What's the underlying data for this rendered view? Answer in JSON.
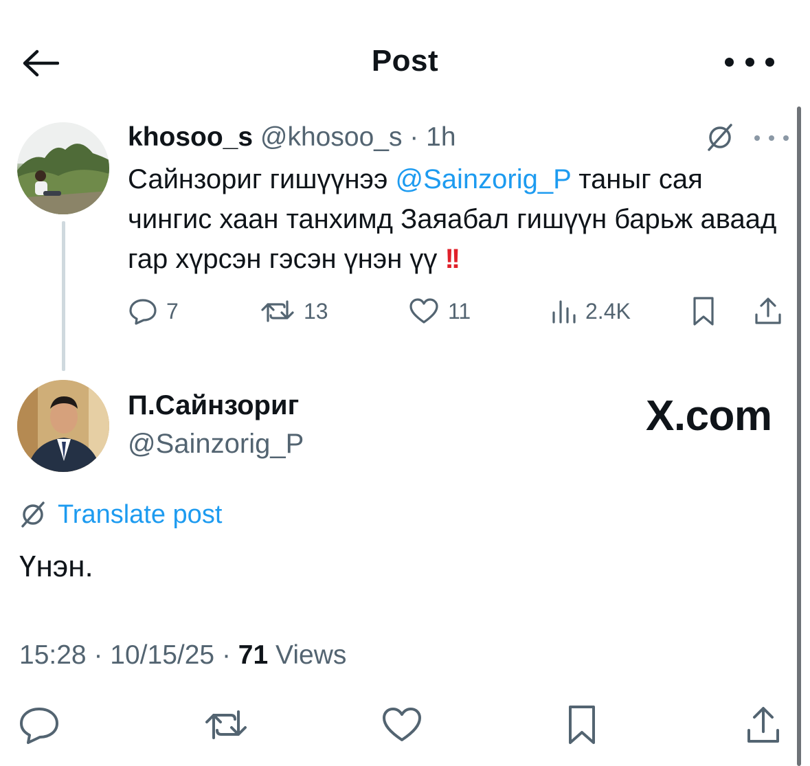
{
  "header": {
    "title": "Post",
    "back_icon": "arrow-left-icon",
    "more_icon": "more-horizontal-icon"
  },
  "parent_tweet": {
    "name": "khosoo_s",
    "handle": "@khosoo_s",
    "separator": "·",
    "time": "1h",
    "text_before": "Сайнзориг гишүүнээ ",
    "mention": "@Sainzorig_P",
    "text_after": " таныг сая чингис хаан танхимд Заяабал гишүүн барьж аваад гар хүрсэн гэсэн үнэн үү ",
    "emphasis": "!!",
    "actions": {
      "replies": "7",
      "reposts": "13",
      "likes": "11",
      "views": "2.4K"
    }
  },
  "reply_tweet": {
    "name": "П.Сайнзориг",
    "handle": "@Sainzorig_P",
    "watermark": "X.com",
    "translate_label": "Translate post",
    "text": "Үнэн.",
    "time": "15:28",
    "date": "10/15/25",
    "separator": "·",
    "views_count": "71",
    "views_label": "Views"
  },
  "colors": {
    "accent": "#1d9bf0",
    "text_primary": "#0f1419",
    "text_secondary": "#536471",
    "alert": "#e0202a"
  }
}
